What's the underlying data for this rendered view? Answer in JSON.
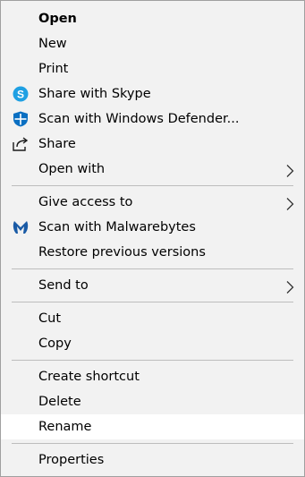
{
  "menu": {
    "groups": [
      {
        "items": [
          {
            "label": "Open",
            "icon": null,
            "submenu": false
          },
          {
            "label": "New",
            "icon": null,
            "submenu": false
          },
          {
            "label": "Print",
            "icon": null,
            "submenu": false
          },
          {
            "label": "Share with Skype",
            "icon": "skype-icon",
            "submenu": false
          },
          {
            "label": "Scan with Windows Defender...",
            "icon": "windows-defender-icon",
            "submenu": false
          },
          {
            "label": "Share",
            "icon": "share-icon",
            "submenu": false
          },
          {
            "label": "Open with",
            "icon": null,
            "submenu": true
          }
        ]
      },
      {
        "items": [
          {
            "label": "Give access to",
            "icon": null,
            "submenu": true
          },
          {
            "label": "Scan with Malwarebytes",
            "icon": "malwarebytes-icon",
            "submenu": false
          },
          {
            "label": "Restore previous versions",
            "icon": null,
            "submenu": false
          }
        ]
      },
      {
        "items": [
          {
            "label": "Send to",
            "icon": null,
            "submenu": true
          }
        ]
      },
      {
        "items": [
          {
            "label": "Cut",
            "icon": null,
            "submenu": false
          },
          {
            "label": "Copy",
            "icon": null,
            "submenu": false
          }
        ]
      },
      {
        "items": [
          {
            "label": "Create shortcut",
            "icon": null,
            "submenu": false
          },
          {
            "label": "Delete",
            "icon": null,
            "submenu": false
          },
          {
            "label": "Rename",
            "icon": null,
            "submenu": false,
            "hovered": true
          }
        ]
      },
      {
        "items": [
          {
            "label": "Properties",
            "icon": null,
            "submenu": false
          }
        ]
      }
    ],
    "colors": {
      "background": "#f2f2f2",
      "hover": "#ffffff",
      "separator": "#bdbdbd",
      "skype": "#1fa0e3",
      "defender": "#0a6fc2",
      "malwarebytes": "#1a5ba6"
    }
  }
}
